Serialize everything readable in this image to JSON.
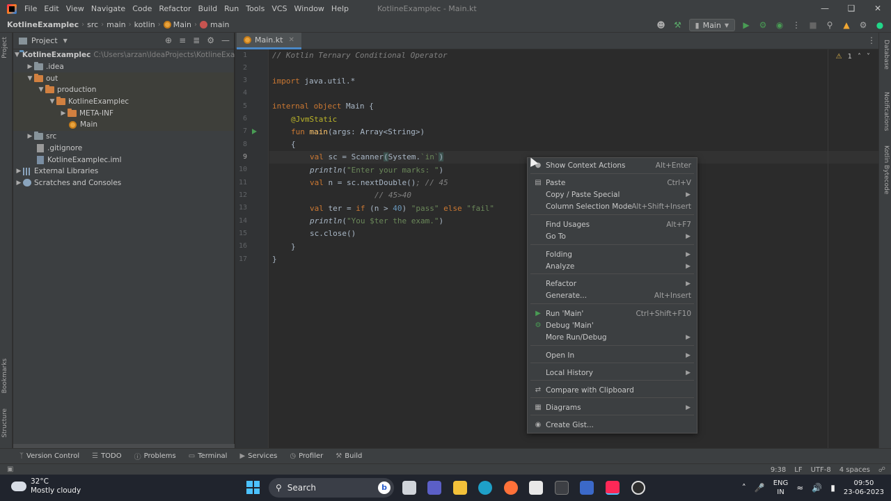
{
  "menubar": {
    "items": [
      "File",
      "Edit",
      "View",
      "Navigate",
      "Code",
      "Refactor",
      "Build",
      "Run",
      "Tools",
      "VCS",
      "Window",
      "Help"
    ],
    "title": "KotlineExamplec - Main.kt"
  },
  "breadcrumb": {
    "project": "KotlineExamplec",
    "parts": [
      "src",
      "main",
      "kotlin"
    ],
    "file": "Main",
    "member": "main"
  },
  "toolbar": {
    "run_config": "Main"
  },
  "left_strip": {
    "project": "Project",
    "bookmarks": "Bookmarks",
    "structure": "Structure"
  },
  "right_strip": {
    "database": "Database",
    "notifications": "Notifications",
    "bytecode": "Kotlin Bytecode"
  },
  "project_panel": {
    "title": "Project",
    "tree": [
      {
        "label": "KotlineExamplec",
        "path": "C:\\Users\\arzan\\IdeaProjects\\KotlineExamplec"
      },
      {
        "label": ".idea"
      },
      {
        "label": "out"
      },
      {
        "label": "production"
      },
      {
        "label": "KotlineExamplec"
      },
      {
        "label": "META-INF"
      },
      {
        "label": "Main"
      },
      {
        "label": "src"
      },
      {
        "label": ".gitignore"
      },
      {
        "label": "KotlineExamplec.iml"
      },
      {
        "label": "External Libraries"
      },
      {
        "label": "Scratches and Consoles"
      }
    ]
  },
  "editor": {
    "tab": "Main.kt",
    "warnings": "1",
    "line_numbers": [
      "1",
      "2",
      "3",
      "4",
      "5",
      "6",
      "7",
      "8",
      "9",
      "10",
      "11",
      "12",
      "13",
      "14",
      "15",
      "16",
      "17"
    ],
    "lines": {
      "l1": "// Kotlin Ternary Conditional Operator",
      "l3_kw": "import",
      "l3_rest": " java.util.*",
      "l5_kw": "internal object",
      "l5_rest": " Main {",
      "l6": "@JvmStatic",
      "l7_kw": "fun",
      "l7_fn": " main",
      "l7_rest": "(args: Array<String>)",
      "l8": "{",
      "l9_kw": "val",
      "l9_a": " sc = Scanner",
      "l9_b": "(",
      "l9_c": "System.",
      "l9_str": "`in`",
      "l9_d": ")",
      "l10_it": "println",
      "l10_a": "(",
      "l10_str": "\"Enter your marks: \"",
      "l10_b": ")",
      "l11_kw": "val",
      "l11_a": " n = sc.nextDouble()",
      "l11_com": "; // 45",
      "l12_com": "// 45>40",
      "l13_kw": "val",
      "l13_a": " ter = ",
      "l13_kw2": "if",
      "l13_b": " (n > ",
      "l13_num": "40",
      "l13_c": ") ",
      "l13_str": "\"pass\"",
      "l13_kw3": " else ",
      "l13_str2": "\"fail\"",
      "l14_it": "println",
      "l14_a": "(",
      "l14_str": "\"You $ter the exam.\"",
      "l14_b": ")",
      "l15": "sc.close()",
      "l16": "}",
      "l17": "}"
    }
  },
  "context_menu": {
    "items": [
      {
        "label": "Show Context Actions",
        "shortcut": "Alt+Enter",
        "icon": "bulb-icon"
      },
      {
        "label": "Paste",
        "shortcut": "Ctrl+V",
        "icon": "clipboard-icon"
      },
      {
        "label": "Copy / Paste Special",
        "submenu": true
      },
      {
        "label": "Column Selection Mode",
        "shortcut": "Alt+Shift+Insert"
      },
      {
        "label": "Find Usages",
        "shortcut": "Alt+F7"
      },
      {
        "label": "Go To",
        "submenu": true
      },
      {
        "label": "Folding",
        "submenu": true
      },
      {
        "label": "Analyze",
        "submenu": true
      },
      {
        "label": "Refactor",
        "submenu": true
      },
      {
        "label": "Generate...",
        "shortcut": "Alt+Insert"
      },
      {
        "label": "Run 'Main'",
        "shortcut": "Ctrl+Shift+F10",
        "icon": "run-icon"
      },
      {
        "label": "Debug 'Main'",
        "icon": "debug-icon"
      },
      {
        "label": "More Run/Debug",
        "submenu": true
      },
      {
        "label": "Open In",
        "submenu": true
      },
      {
        "label": "Local History",
        "submenu": true
      },
      {
        "label": "Compare with Clipboard",
        "icon": "compare-icon"
      },
      {
        "label": "Diagrams",
        "submenu": true,
        "icon": "diagram-icon"
      },
      {
        "label": "Create Gist...",
        "icon": "github-icon"
      }
    ]
  },
  "tool_windows": [
    "Version Control",
    "TODO",
    "Problems",
    "Terminal",
    "Services",
    "Profiler",
    "Build"
  ],
  "status_bar": {
    "position": "9:38",
    "line_sep": "LF",
    "encoding": "UTF-8",
    "indent": "4 spaces"
  },
  "taskbar": {
    "temp": "32°C",
    "weather": "Mostly cloudy",
    "search": "Search",
    "lang": "ENG",
    "region": "IN",
    "time": "09:50",
    "date": "23-06-2023"
  },
  "colors": {
    "keyword": "#cc7832",
    "string": "#6a8759",
    "comment": "#808080",
    "annotation": "#bbb529",
    "function": "#ffc66d",
    "number": "#6897bb",
    "accent": "#4a88c7"
  }
}
